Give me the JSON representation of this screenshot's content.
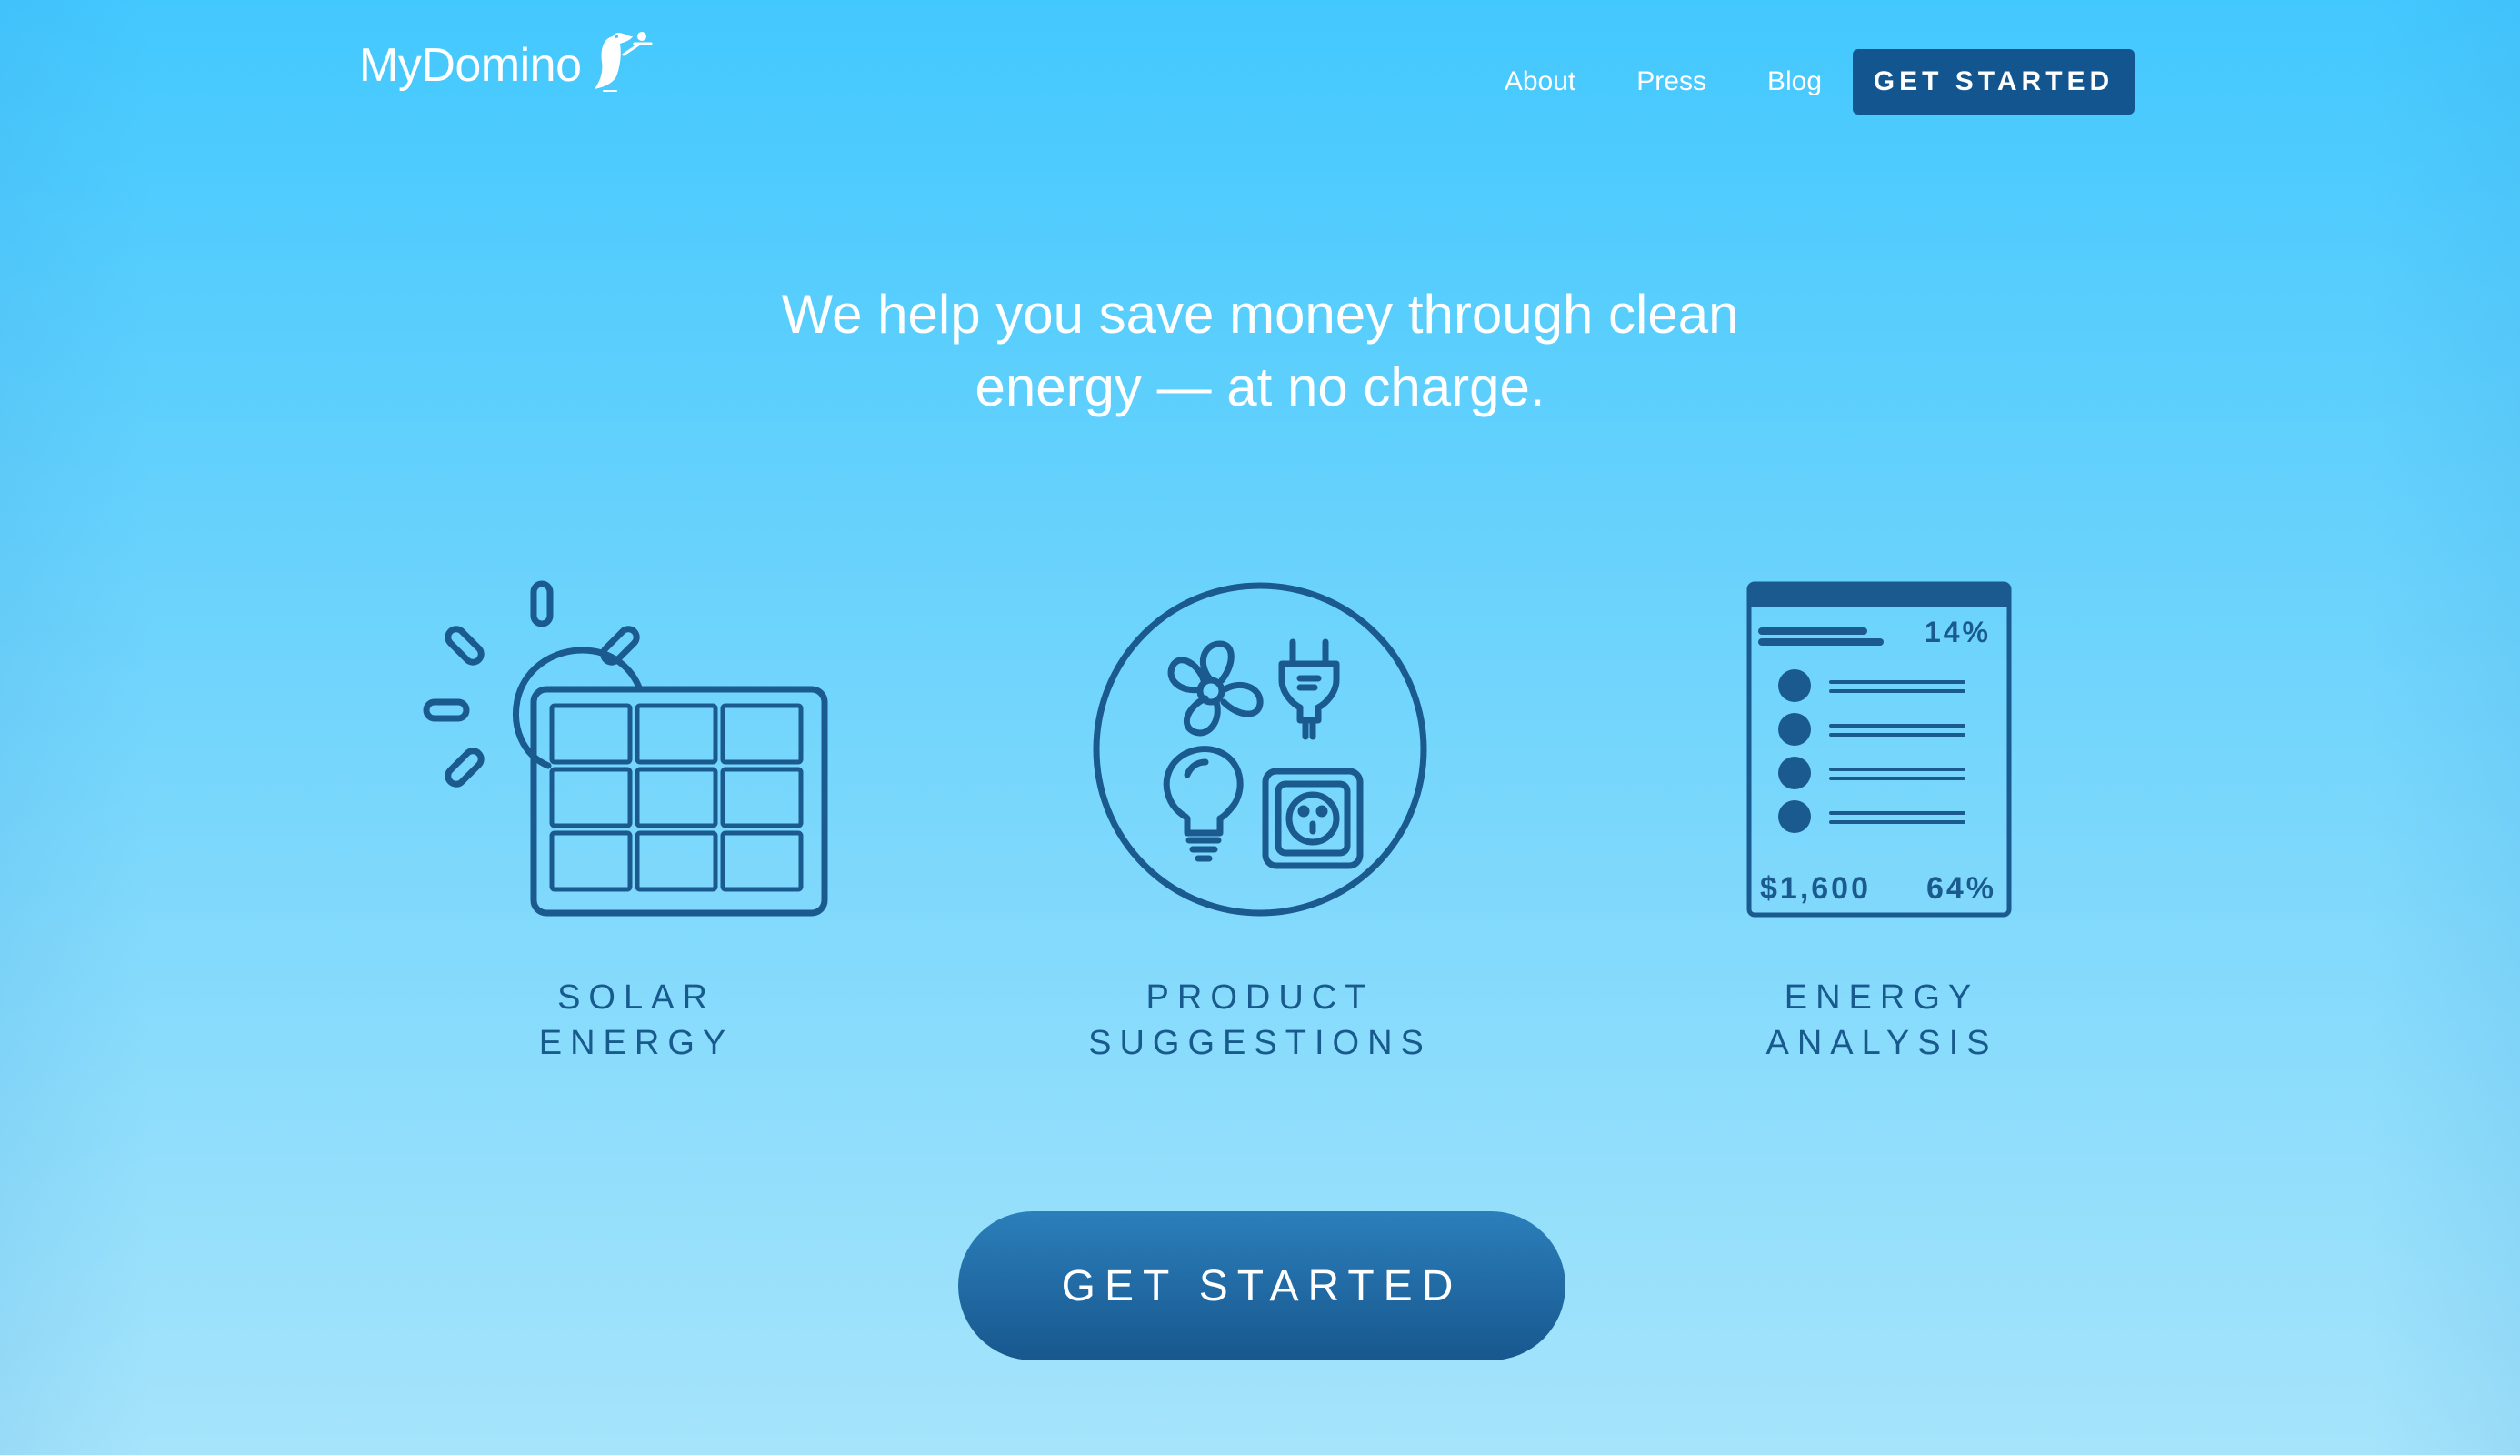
{
  "header": {
    "logo_text": "MyDomino",
    "nav": [
      {
        "label": "About"
      },
      {
        "label": "Press"
      },
      {
        "label": "Blog"
      }
    ],
    "cta_label": "GET STARTED"
  },
  "hero": {
    "headline_line1": "We help you save money through clean",
    "headline_line2": "energy — at no charge."
  },
  "features": [
    {
      "line1": "SOLAR",
      "line2": "ENERGY",
      "icon": "solar-panel-icon"
    },
    {
      "line1": "PRODUCT",
      "line2": "SUGGESTIONS",
      "icon": "appliances-icon"
    },
    {
      "line1": "ENERGY",
      "line2": "ANALYSIS",
      "icon": "energy-report-icon"
    }
  ],
  "report_icon": {
    "top_percent": "14%",
    "bottom_amount": "$1,600",
    "bottom_percent": "64%"
  },
  "cta": {
    "label": "GET STARTED"
  },
  "colors": {
    "background_top": "#43c8fe",
    "background_bottom": "#a6e4fb",
    "accent_dark": "#13568f",
    "icon_stroke": "#1a5a8e"
  }
}
